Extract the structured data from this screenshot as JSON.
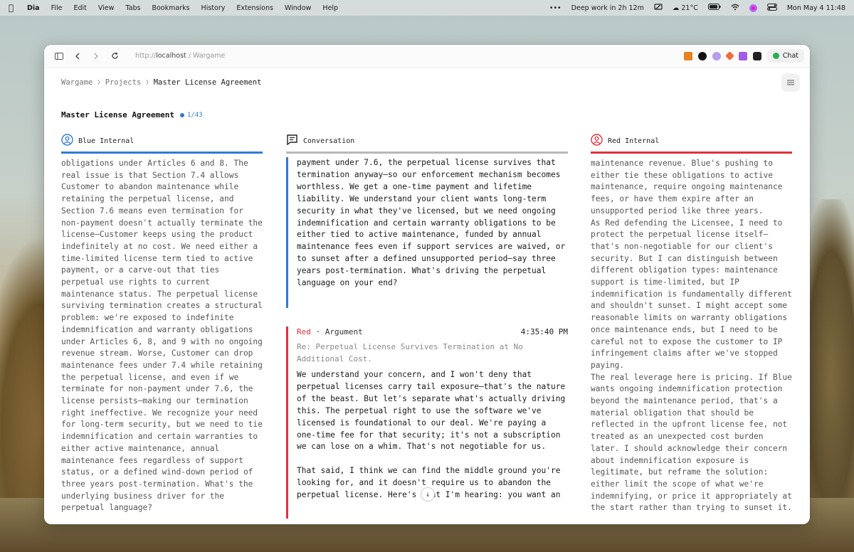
{
  "menubar": {
    "app_name": "Dia",
    "menus": [
      "File",
      "Edit",
      "View",
      "Tabs",
      "Bookmarks",
      "History",
      "Extensions",
      "Window",
      "Help"
    ],
    "focus_status": "Deep work in 2h 12m",
    "weather": "21°C",
    "datetime": "Mon May 4  11:48"
  },
  "browser": {
    "url_scheme": "http://",
    "url_host": "localhost",
    "url_rest": " / Wargame",
    "chat_label": "Chat"
  },
  "breadcrumb": {
    "items": [
      "Wargame",
      "Projects"
    ],
    "current": "Master License Agreement"
  },
  "document": {
    "title": "Master License Agreement",
    "pager": "1/43"
  },
  "colors": {
    "blue": "#2f7bd6",
    "red": "#e0313a",
    "conversation_bar": "#b8b8b8"
  },
  "columns": {
    "blue": {
      "label": "Blue Internal",
      "text": "obligations under Articles 6 and 8. The real issue is that Section 7.4 allows Customer to abandon maintenance while retaining the perpetual license, and Section 7.6 means even termination for non-payment doesn't actually terminate the license—Customer keeps using the product indefinitely at no cost. We need either a time-limited license term tied to active payment, or a carve-out that ties perpetual use rights to current maintenance status. The perpetual license surviving termination creates a structural problem: we're exposed to indefinite indemnification and warranty obligations under Articles 6, 8, and 9 with no ongoing revenue stream. Worse, Customer can drop maintenance fees under 7.4 while retaining the perpetual license, and even if we terminate for non-payment under 7.6, the license persists—making our termination right ineffective. We recognize your need for long-term security, but we need to tie indemnification and certain warranties to either active maintenance, annual maintenance fees regardless of support status, or a defined wind-down period of three years post-termination. What's the underlying business driver for the perpetual language?"
    },
    "conversation": {
      "label": "Conversation",
      "prev_message": "payment under 7.6, the perpetual license survives that termination anyway—so our enforcement mechanism becomes worthless. We get a one-time payment and lifetime liability. We understand your client wants long-term security in what they've licensed, but we need ongoing indemnification and certain warranty obligations to be either tied to active maintenance, funded by annual maintenance fees even if support services are waived, or to sunset after a defined unsupported period—say three years post-termination. What's driving the perpetual language on your end?",
      "message": {
        "speaker": "Red",
        "type": "· Argument",
        "time": "4:35:40 PM",
        "subject": "Re: Perpetual License Survives Termination at No Additional Cost.",
        "para1": "We understand your concern, and I won't deny that perpetual licenses carry tail exposure—that's the nature of the beast. But let's separate what's actually driving this. The perpetual right to use the software we've licensed is foundational to our deal. We're paying a one-time fee for that security; it's not a subscription we can lose on a whim. That's not negotiable for us.",
        "para2": "That said, I think we can find the middle ground you're looking for, and it doesn't require us to abandon the perpetual license. Here's what I'm hearing: you want an"
      }
    },
    "red": {
      "label": "Red Internal",
      "text1": "maintenance revenue. Blue's pushing to either tie these obligations to active maintenance, require ongoing maintenance fees, or have them expire after an unsupported period like three years.",
      "text2": "As Red defending the Licensee, I need to protect the perpetual license itself—that's non-negotiable for our client's security. But I can distinguish between different obligation types: maintenance support is time-limited, but IP indemnification is fundamentally different and shouldn't sunset. I might accept some reasonable limits on warranty obligations once maintenance ends, but I need to be careful not to expose the customer to IP infringement claims after we've stopped paying.",
      "text3": "The real leverage here is pricing. If Blue wants ongoing indemnification protection beyond the maintenance period, that's a material obligation that should be reflected in the upfront license fee, not treated as an unexpected cost burden later. I should acknowledge their concern about indemnification exposure is legitimate, but reframe the solution: either limit the scope of what we're indemnifying, or price it appropriately at the start rather than trying to sunset it."
    }
  }
}
